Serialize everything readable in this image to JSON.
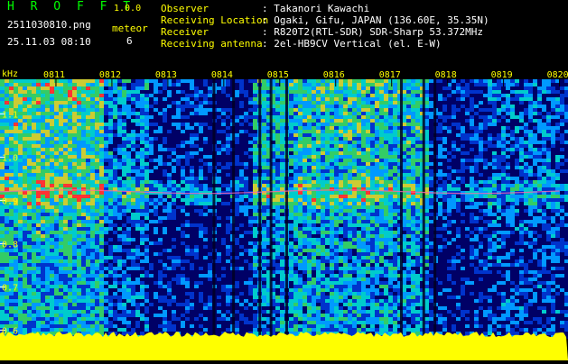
{
  "header": {
    "app_title": "H R O F F T",
    "app_version": "1.0.0",
    "file_name": "2511030810.png",
    "meteor_label": "meteor",
    "meteor_count": "6",
    "datetime": "25.11.03 08:10",
    "info": [
      {
        "label": "Observer",
        "value": ": Takanori Kawachi"
      },
      {
        "label": "Receiving Location",
        "value": ": Ogaki, Gifu, JAPAN (136.60E, 35.35N)"
      },
      {
        "label": "Receiver",
        "value": ": R820T2(RTL-SDR) SDR-Sharp 53.372MHz"
      },
      {
        "label": "Receiving antenna",
        "value": ": 2el-HB9CV Vertical (el. E-W)"
      }
    ]
  },
  "colors": {
    "header_green": "#00ff00",
    "header_yellow": "#ffff00",
    "tick_label": "#ffff00",
    "noise_floor": "#ffff00",
    "background": "#000000"
  },
  "chart_data": {
    "type": "heatmap",
    "title": "",
    "xlabel": "",
    "ylabel": "kHz",
    "x_unit": "time (HHMM)",
    "x_ticks": [
      "0811",
      "0812",
      "0813",
      "0814",
      "0815",
      "0816",
      "0817",
      "0818",
      "0819",
      "0820"
    ],
    "y_ticks": [
      1.1,
      1.0,
      0.9,
      0.8,
      0.7,
      0.6
    ],
    "ylim": [
      0.58,
      1.18
    ],
    "xlim": [
      "0810",
      "0820"
    ],
    "colormap": [
      "#000066",
      "#0033cc",
      "#0099ff",
      "#00cccc",
      "#33cc66",
      "#cccc33",
      "#ff3333"
    ],
    "carrier_freq_khz": 0.92,
    "signal_intensity": [
      {
        "start": 0.0,
        "end": 1.85,
        "level": 0.78
      },
      {
        "start": 1.85,
        "end": 2.6,
        "level": 0.42
      },
      {
        "start": 2.6,
        "end": 3.6,
        "level": 0.18
      },
      {
        "start": 3.6,
        "end": 4.5,
        "level": 0.12
      },
      {
        "start": 4.5,
        "end": 5.2,
        "level": 0.55
      },
      {
        "start": 5.2,
        "end": 6.8,
        "level": 0.66
      },
      {
        "start": 6.8,
        "end": 7.6,
        "level": 0.62
      },
      {
        "start": 7.6,
        "end": 8.7,
        "level": 0.14
      },
      {
        "start": 8.7,
        "end": 10.0,
        "level": 0.3
      }
    ],
    "dropouts": [
      3.8,
      4.15,
      4.62,
      4.82,
      5.1,
      7.15,
      7.55,
      7.75
    ],
    "meteor_count": 6
  }
}
